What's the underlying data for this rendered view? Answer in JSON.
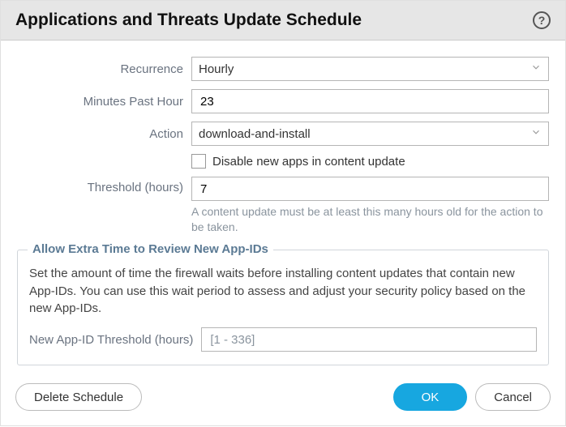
{
  "title": "Applications and Threats Update Schedule",
  "labels": {
    "recurrence": "Recurrence",
    "minutesPastHour": "Minutes Past Hour",
    "action": "Action",
    "disableNewApps": "Disable new apps in content update",
    "threshold": "Threshold (hours)",
    "thresholdHint": "A content update must be at least this many hours old for the action to be taken.",
    "newAppIdThreshold": "New App-ID Threshold (hours)"
  },
  "values": {
    "recurrence": "Hourly",
    "minutesPastHour": "23",
    "action": "download-and-install",
    "threshold": "7",
    "newAppIdThreshold": ""
  },
  "placeholders": {
    "newAppIdThreshold": "[1 - 336]"
  },
  "fieldset": {
    "legend": "Allow Extra Time to Review New App-IDs",
    "desc": "Set the amount of time the firewall waits before installing content updates that contain new App-IDs. You can use this wait period to assess and adjust your security policy based on the new App-IDs."
  },
  "buttons": {
    "delete": "Delete Schedule",
    "ok": "OK",
    "cancel": "Cancel"
  }
}
